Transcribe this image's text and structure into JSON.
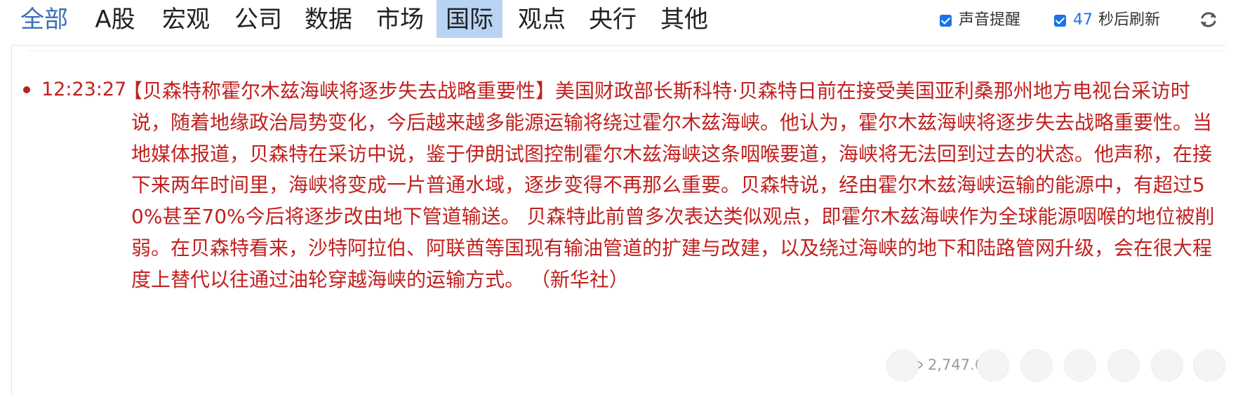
{
  "nav": {
    "tabs": [
      "全部",
      "A股",
      "宏观",
      "公司",
      "数据",
      "市场",
      "国际",
      "观点",
      "央行",
      "其他"
    ]
  },
  "controls": {
    "sound_label": "声音提醒",
    "refresh_count": "47",
    "refresh_label": "秒后刷新"
  },
  "news": {
    "time": "12:23:27",
    "title": "【贝森特称霍尔木兹海峡将逐步失去战略重要性】",
    "body": "美国财政部长斯科特·贝森特日前在接受美国亚利桑那州地方电视台采访时说，随着地缘政治局势变化，今后越来越多能源运输将绕过霍尔木兹海峡。他认为，霍尔木兹海峡将逐步失去战略重要性。当地媒体报道，贝森特在采访中说，鉴于伊朗试图控制霍尔木兹海峡这条咽喉要道，海峡将无法回到过去的状态。他声称，在接下来两年时间里，海峡将变成一片普通水域，逐步变得不再那么重要。贝森特说，经由霍尔木兹海峡运输的能源中，有超过50%甚至70%今后将逐步改由地下管道输送。 贝森特此前曾多次表达类似观点，即霍尔木兹海峡作为全球能源咽喉的地位被削弱。在贝森特看来，沙特阿拉伯、阿联酋等国现有输油管道的扩建与改建，以及绕过海峡的地下和陆路管网升级，会在很大程度上替代以往通过油轮穿越海峡的运输方式。 （新华社）",
    "views": "2,747.6"
  },
  "colors": {
    "news_red": "#c0211f",
    "accent_blue": "#3a6fb5",
    "selected_tab_bg": "#b9d3f2",
    "checkbox_blue": "#1a73e8"
  },
  "icons": [
    "checkbox-checked-icon",
    "refresh-icon",
    "eye-icon",
    "bullet-dot-icon"
  ]
}
